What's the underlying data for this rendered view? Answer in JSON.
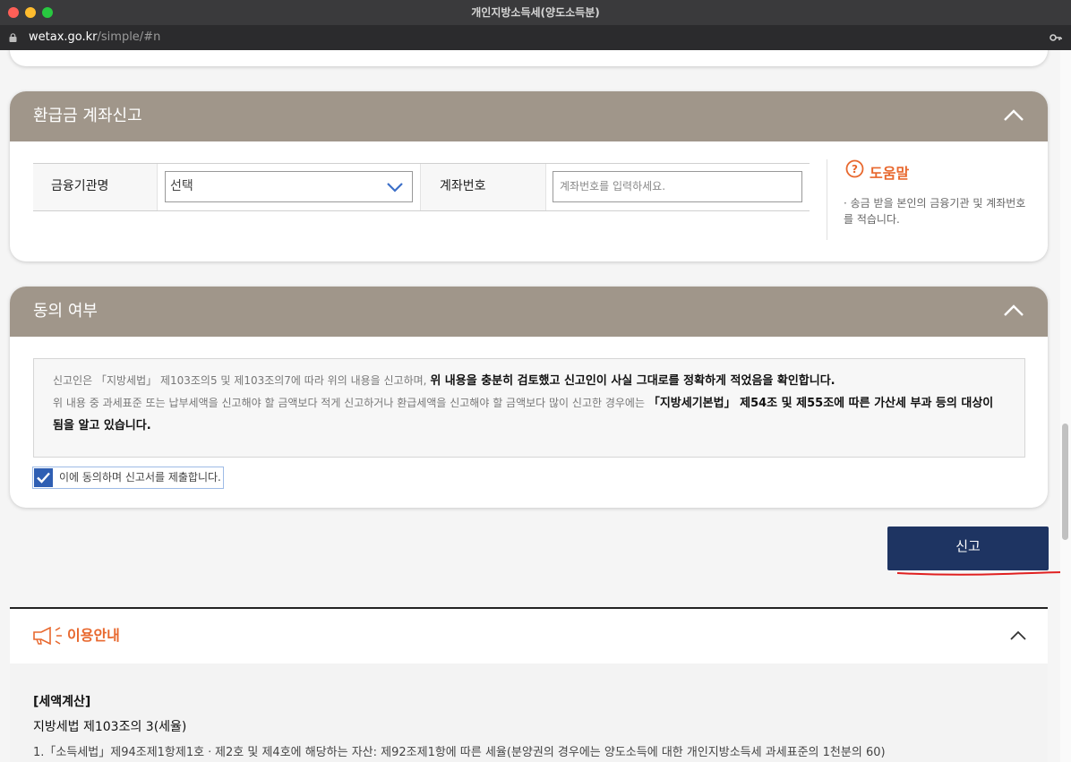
{
  "window": {
    "title": "개인지방소득세(양도소득분)",
    "url_host": "wetax.go.kr",
    "url_path": "/simple/#n"
  },
  "refund_section": {
    "title": "환급금 계좌신고",
    "bank_label": "금융기관명",
    "bank_select_value": "선택",
    "account_label": "계좌번호",
    "account_placeholder": "계좌번호를 입력하세요.",
    "help_title": "도움말",
    "help_text": "· 송금 받을 본인의 금융기관 및 계좌번호를 적습니다."
  },
  "consent_section": {
    "title": "동의 여부",
    "text_1": "신고인은 「지방세법」 제103조의5 및 제103조의7에 따라 위의 내용을 신고하며, ",
    "text_1_bold": "위 내용을 충분히 검토했고 신고인이 사실 그대로를 정확하게 적었음을 확인합니다.",
    "text_2": "위 내용 중 과세표준 또는 납부세액을 신고해야 할 금액보다 적게 신고하거나 환급세액을 신고해야 할 금액보다 많이 신고한 경우에는 ",
    "text_2_bold": "「지방세기본법」 제54조 및 제55조에 따른 가산세 부과 등의 대상이 됨을 알고 있습니다.",
    "checkbox_label": "이에 동의하며 신고서를 제출합니다.",
    "checkbox_checked": true
  },
  "submit_label": "신고",
  "usage": {
    "title": "이용안내",
    "heading": "[세액계산]",
    "subheading": "지방세법 제103조의 3(세율)",
    "line_1": "1.「소득세법」제94조제1항제1호ㆍ제2호 및 제4호에 해당하는 자산: 제92조제1항에 따른 세율(분양권의 경우에는 양도소득에 대한 개인지방소득세 과세표준의 1천분의 60)"
  },
  "colors": {
    "section_header": "#a0968a",
    "submit_button": "#1e3462",
    "accent_orange": "#e8682e",
    "checkbox_blue": "#2f5fb3"
  }
}
